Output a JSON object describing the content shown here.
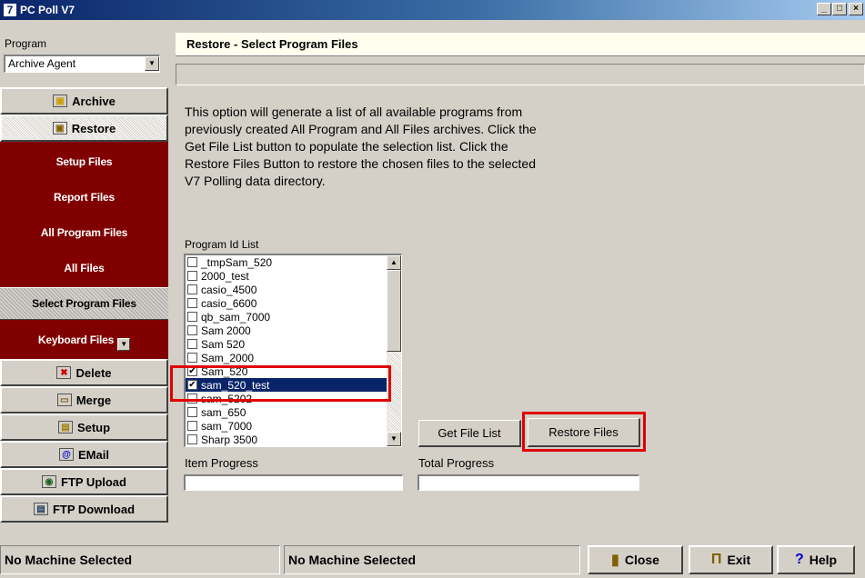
{
  "window": {
    "title": "PC Poll V7",
    "app_icon": "7",
    "controls": [
      "_",
      "□",
      "×"
    ]
  },
  "sidebar": {
    "program_label": "Program",
    "program_value": "Archive Agent",
    "nav": [
      {
        "label": "Archive",
        "icon": "archive-icon",
        "glyph": "▣",
        "color": "#c8a000"
      },
      {
        "label": "Restore",
        "icon": "restore-icon",
        "glyph": "▣",
        "color": "#806000",
        "active": true
      }
    ],
    "subnav": [
      {
        "label": "Setup Files"
      },
      {
        "label": "Report Files"
      },
      {
        "label": "All Program Files"
      },
      {
        "label": "All Files"
      },
      {
        "label": "Select Program Files",
        "selected": true
      },
      {
        "label": "Keyboard Files",
        "has_dropdown": true
      }
    ],
    "nav_bottom": [
      {
        "label": "Delete",
        "icon": "delete-icon",
        "glyph": "✖",
        "color": "#cc0000"
      },
      {
        "label": "Merge",
        "icon": "merge-folder-icon",
        "glyph": "▭",
        "color": "#806020"
      },
      {
        "label": "Setup",
        "icon": "setup-icon",
        "glyph": "▤",
        "color": "#a08000"
      },
      {
        "label": "EMail",
        "icon": "email-at-icon",
        "glyph": "@",
        "color": "#0000cc"
      },
      {
        "label": "FTP Upload",
        "icon": "ftp-upload-icon",
        "glyph": "◉",
        "color": "#206020"
      },
      {
        "label": "FTP Download",
        "icon": "ftp-download-icon",
        "glyph": "▤",
        "color": "#204060"
      }
    ]
  },
  "main": {
    "header": "Restore - Select Program Files",
    "description": "This option will generate a list of all available programs from previously created All Program and All Files archives. Click the Get File List button to populate the selection list. Click the Restore Files Button to restore the chosen files to the selected V7 Polling data directory.",
    "list_label": "Program Id List",
    "programs": [
      {
        "name": "_tmpSam_520",
        "checked": false
      },
      {
        "name": "2000_test",
        "checked": false
      },
      {
        "name": "casio_4500",
        "checked": false
      },
      {
        "name": "casio_6600",
        "checked": false
      },
      {
        "name": "qb_sam_7000",
        "checked": false
      },
      {
        "name": "Sam 2000",
        "checked": false
      },
      {
        "name": "Sam 520",
        "checked": false
      },
      {
        "name": "Sam_2000",
        "checked": false
      },
      {
        "name": "Sam_520",
        "checked": true
      },
      {
        "name": "sam_520_test",
        "checked": true,
        "selected": true
      },
      {
        "name": "sam_5202",
        "checked": false
      },
      {
        "name": "sam_650",
        "checked": false
      },
      {
        "name": "sam_7000",
        "checked": false
      },
      {
        "name": "Sharp 3500",
        "checked": false
      }
    ],
    "get_file_list_label": "Get File List",
    "restore_files_label": "Restore Files",
    "item_progress_label": "Item Progress",
    "total_progress_label": "Total Progress",
    "item_progress": 0,
    "total_progress": 0
  },
  "statusbar": {
    "left_text": "No Machine Selected",
    "mid_text": "No Machine Selected",
    "close_label": "Close",
    "exit_label": "Exit",
    "help_label": "Help"
  }
}
